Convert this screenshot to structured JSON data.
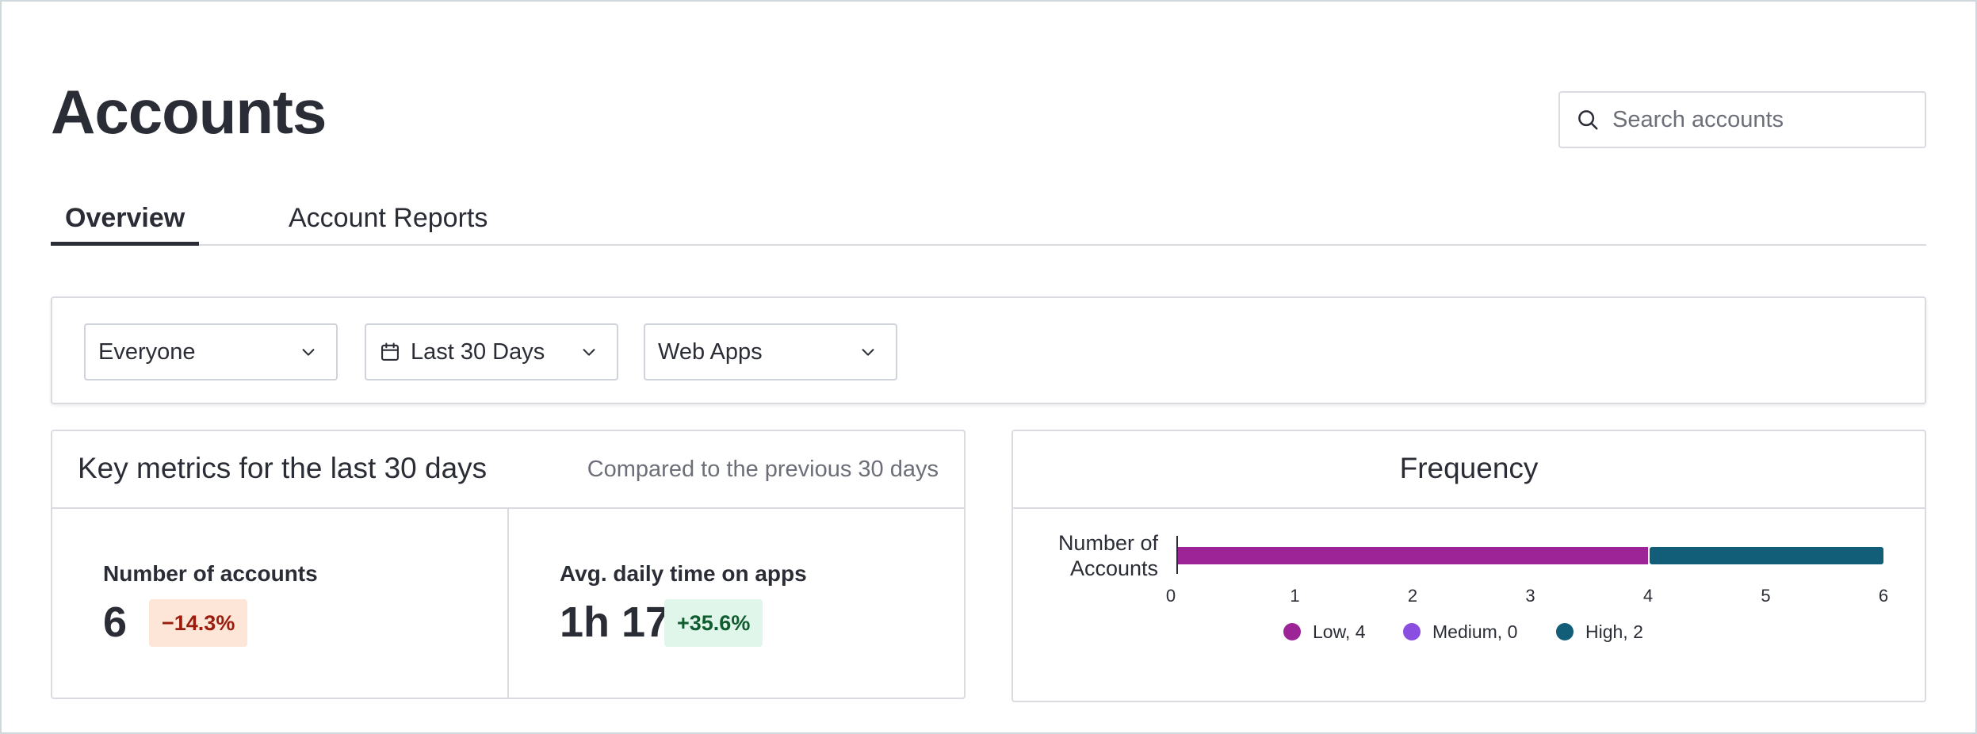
{
  "page": {
    "title": "Accounts"
  },
  "search": {
    "placeholder": "Search accounts",
    "icon": "search-icon"
  },
  "tabs": [
    {
      "label": "Overview",
      "active": true
    },
    {
      "label": "Account Reports",
      "active": false
    }
  ],
  "filters": {
    "audience": {
      "value": "Everyone"
    },
    "date_range": {
      "value": "Last 30 Days",
      "icon": "calendar-icon"
    },
    "app_type": {
      "value": "Web Apps"
    }
  },
  "metrics": {
    "title": "Key metrics for the last 30 days",
    "comparison": "Compared to the previous 30 days",
    "items": [
      {
        "label": "Number of accounts",
        "value": "6",
        "change": "−14.3%",
        "trend": "down"
      },
      {
        "label": "Avg. daily time on apps",
        "value": "1h 17m",
        "change": "+35.6%",
        "trend": "up"
      }
    ]
  },
  "colors": {
    "low": "#9c2496",
    "medium": "#8a4fe0",
    "high": "#125e78",
    "negative_badge_bg": "#fde5d8",
    "positive_badge_bg": "#e1f6ea"
  },
  "chart_data": {
    "type": "bar",
    "orientation": "horizontal",
    "stacked": true,
    "title": "Frequency",
    "categories": [
      "Number of Accounts"
    ],
    "series": [
      {
        "name": "Low",
        "values": [
          4
        ],
        "color": "#9c2496"
      },
      {
        "name": "Medium",
        "values": [
          0
        ],
        "color": "#8a4fe0"
      },
      {
        "name": "High",
        "values": [
          2
        ],
        "color": "#125e78"
      }
    ],
    "xlim": [
      0,
      6
    ],
    "xticks": [
      "0",
      "1",
      "2",
      "3",
      "4",
      "5",
      "6"
    ],
    "legend": [
      "Low, 4",
      "Medium, 0",
      "High, 2"
    ],
    "legend_position": "bottom",
    "grid": false
  }
}
